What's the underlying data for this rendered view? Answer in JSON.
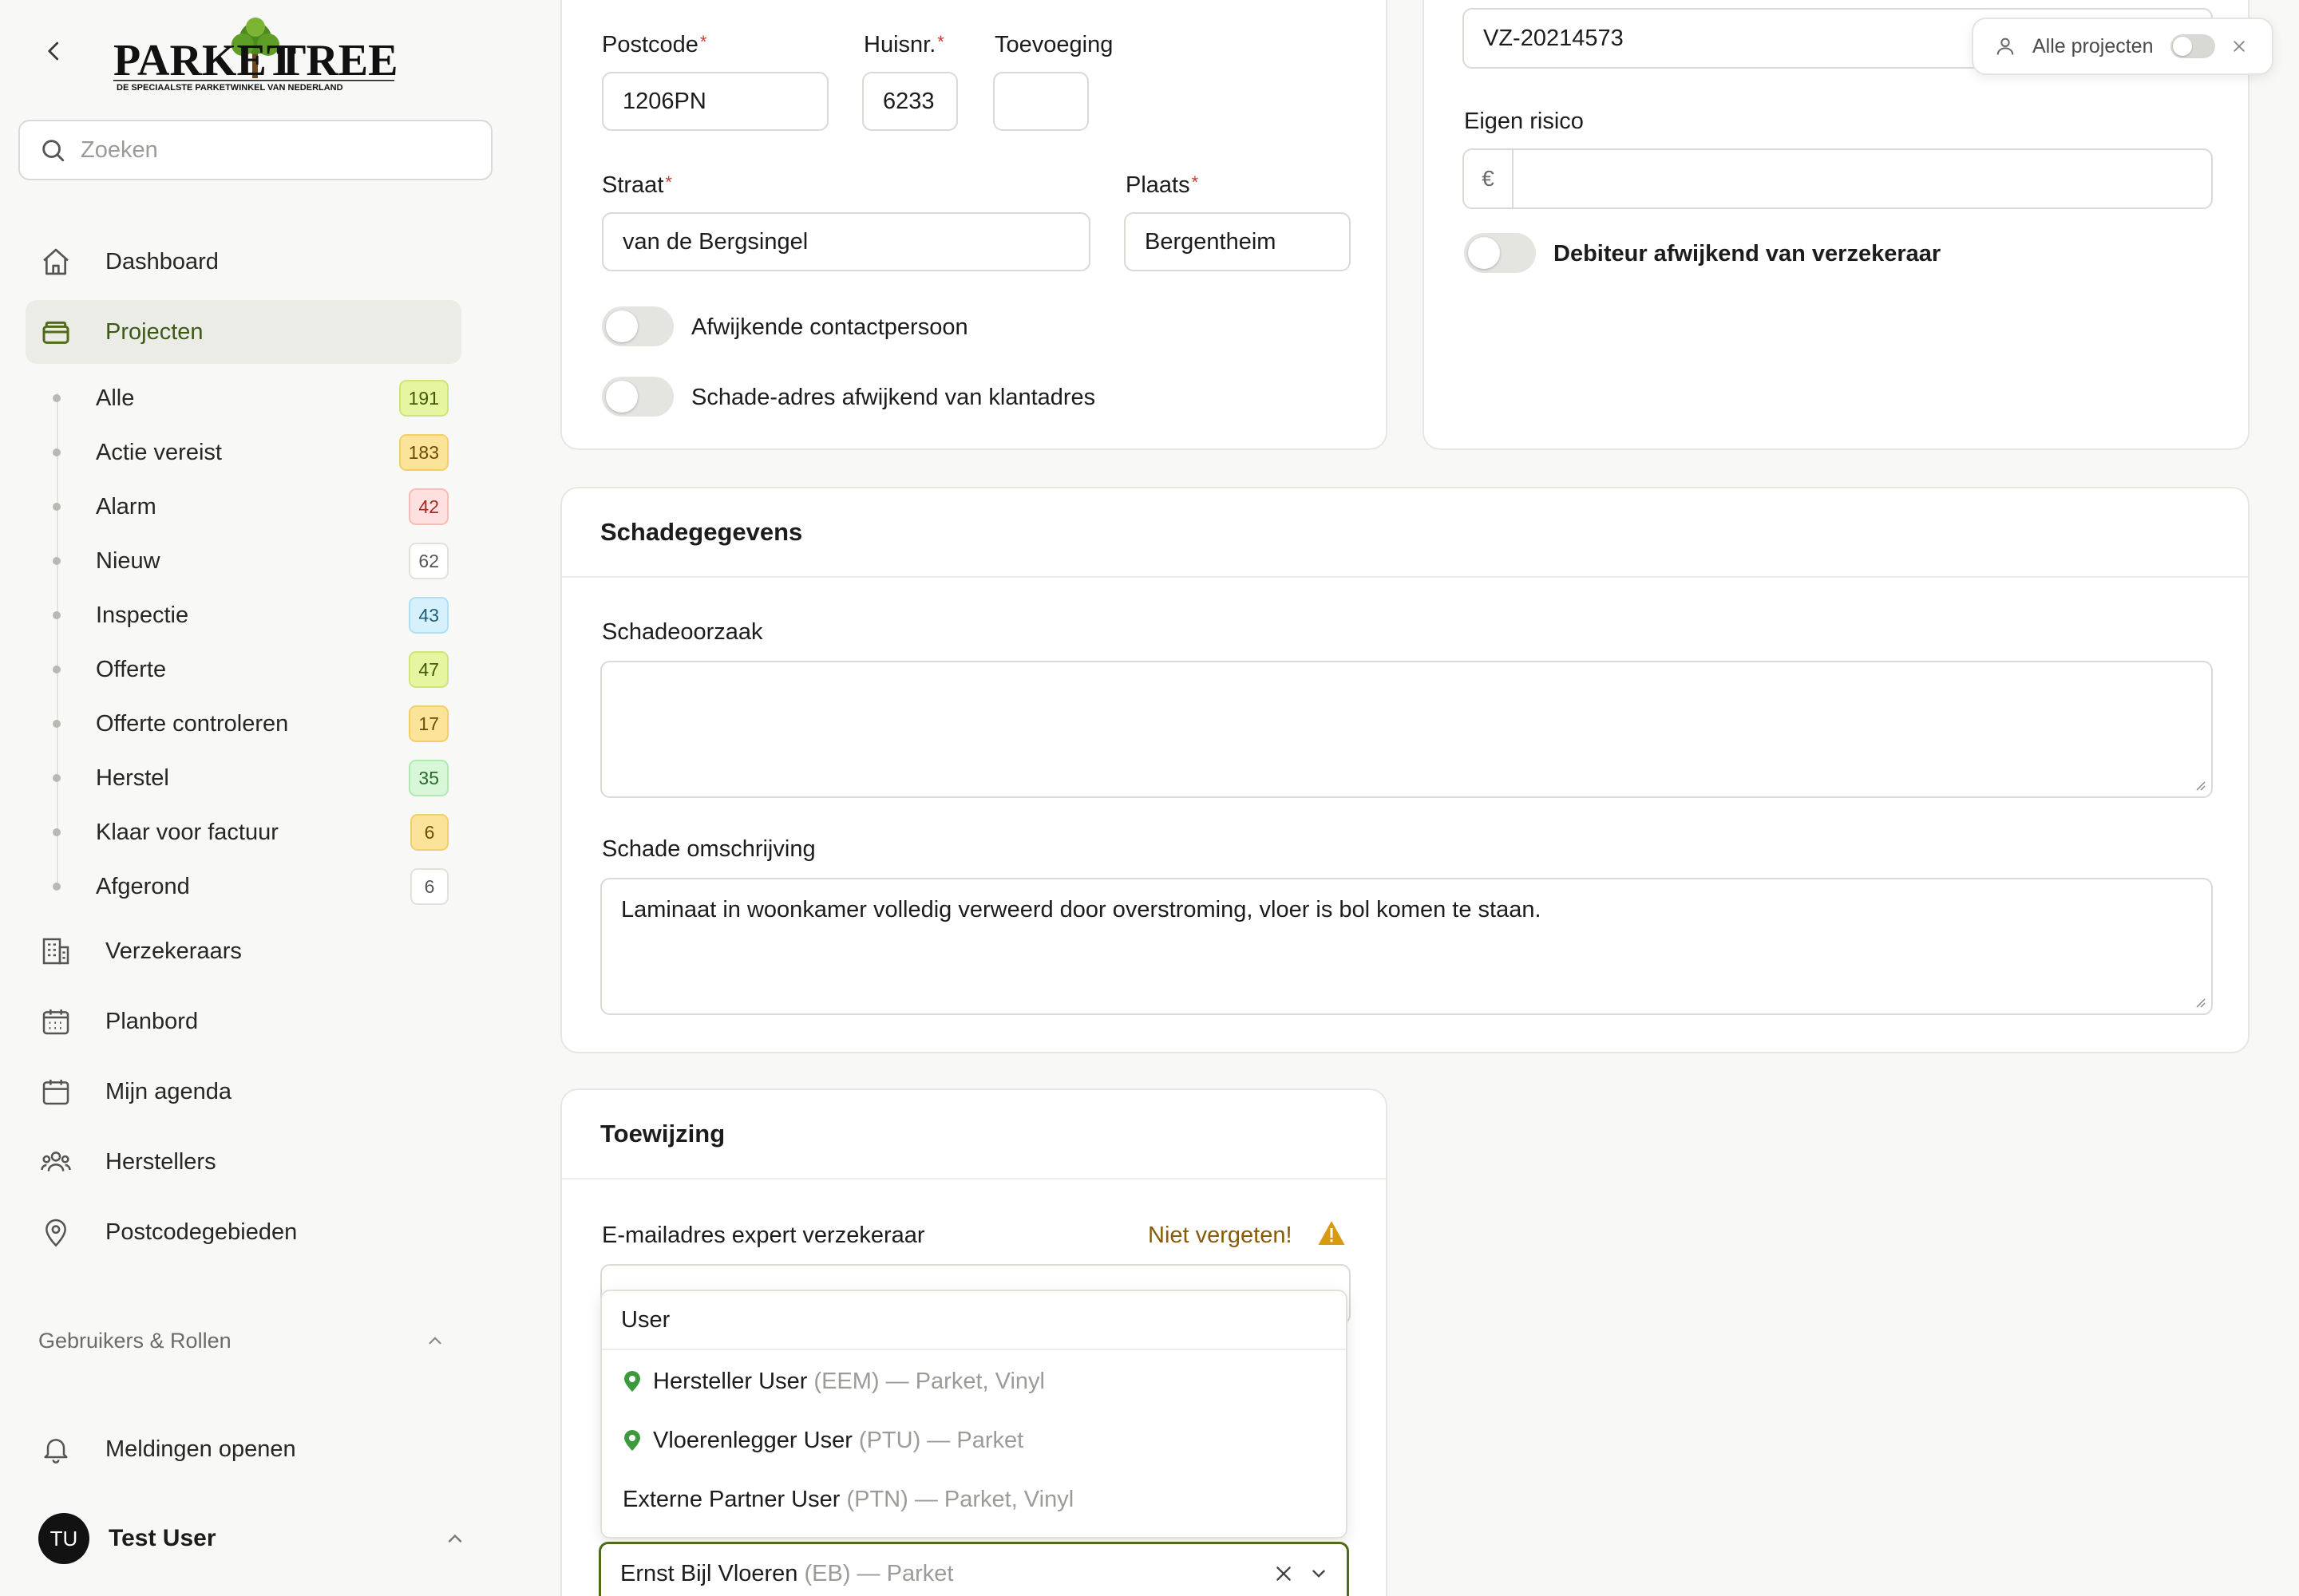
{
  "sidebar": {
    "logo_text_main": "PARKET TREE",
    "logo_tagline": "DE SPECIAALSTE PARKETWINKEL VAN NEDERLAND",
    "search_placeholder": "Zoeken",
    "nav": [
      {
        "label": "Dashboard",
        "icon": "home-icon"
      },
      {
        "label": "Projecten",
        "icon": "folder-icon",
        "active": true
      },
      {
        "label": "Verzekeraars",
        "icon": "building-icon"
      },
      {
        "label": "Planbord",
        "icon": "calendar-grid-icon"
      },
      {
        "label": "Mijn agenda",
        "icon": "calendar-icon"
      },
      {
        "label": "Herstellers",
        "icon": "users-icon"
      },
      {
        "label": "Postcodegebieden",
        "icon": "map-pin-icon"
      }
    ],
    "sub_items": [
      {
        "label": "Alle",
        "count": "191",
        "bg": "#e6f5a0",
        "fg": "#3f5a08",
        "border": "#cfe57a"
      },
      {
        "label": "Actie vereist",
        "count": "183",
        "bg": "#fbe49a",
        "fg": "#6b4b05",
        "border": "#f2cf6b"
      },
      {
        "label": "Alarm",
        "count": "42",
        "bg": "#fde0df",
        "fg": "#a52a25",
        "border": "#f6bcb9"
      },
      {
        "label": "Nieuw",
        "count": "62",
        "bg": "#ffffff",
        "fg": "#555555",
        "border": "#e1e1dd"
      },
      {
        "label": "Inspectie",
        "count": "43",
        "bg": "#d6f1fb",
        "fg": "#1b5f7a",
        "border": "#aee0f2"
      },
      {
        "label": "Offerte",
        "count": "47",
        "bg": "#e6f5a0",
        "fg": "#3f5a08",
        "border": "#cfe57a"
      },
      {
        "label": "Offerte controleren",
        "count": "17",
        "bg": "#fbe49a",
        "fg": "#6b4b05",
        "border": "#f2cf6b"
      },
      {
        "label": "Herstel",
        "count": "35",
        "bg": "#d8f6d8",
        "fg": "#2a6b2a",
        "border": "#b2e8b2"
      },
      {
        "label": "Klaar voor factuur",
        "count": "6",
        "bg": "#fbe49a",
        "fg": "#6b4b05",
        "border": "#f2cf6b"
      },
      {
        "label": "Afgerond",
        "count": "6",
        "bg": "#ffffff",
        "fg": "#555555",
        "border": "#e1e1dd"
      }
    ],
    "section_users": "Gebruikers & Rollen",
    "notifications": "Meldingen openen",
    "user": {
      "initials": "TU",
      "name": "Test User"
    }
  },
  "address": {
    "postcode_label": "Postcode",
    "postcode_value": "1206PN",
    "huisnr_label": "Huisnr.",
    "huisnr_value": "6233",
    "toevoeging_label": "Toevoeging",
    "toevoeging_value": "",
    "straat_label": "Straat",
    "straat_value": "van de Bergsingel",
    "plaats_label": "Plaats",
    "plaats_value": "Bergentheim",
    "toggle_contact": "Afwijkende contactpersoon",
    "toggle_schade_adres": "Schade-adres afwijkend van klantadres"
  },
  "insurance": {
    "polis_value": "VZ-20214573",
    "eigen_risico_label": "Eigen risico",
    "currency_symbol": "€",
    "eigen_risico_value": "",
    "toggle_debiteur": "Debiteur afwijkend van verzekeraar"
  },
  "filter_pill": {
    "label": "Alle projecten"
  },
  "schade": {
    "title": "Schadegegevens",
    "oorzaak_label": "Schadeoorzaak",
    "oorzaak_value": "",
    "omschrijving_label": "Schade omschrijving",
    "omschrijving_value": "Laminaat in woonkamer volledig verweerd door overstroming, vloer is bol komen te staan."
  },
  "toewijzing": {
    "title": "Toewijzing",
    "email_label": "E-mailadres expert verzekeraar",
    "warning_text": "Niet vergeten!",
    "dropdown_search": "User",
    "options": [
      {
        "name": "Hersteller User",
        "suffix": " (EEM) — Parket, Vinyl",
        "pin": true
      },
      {
        "name": "Vloerenlegger User",
        "suffix": " (PTU) — Parket",
        "pin": true
      },
      {
        "name": "Externe Partner User",
        "suffix": " (PTN) — Parket, Vinyl",
        "pin": false
      }
    ],
    "selected_name": "Ernst Bijl Vloeren",
    "selected_suffix": " (EB) — Parket"
  },
  "colors": {
    "accent": "#4f6b19",
    "warning": "#c98a0c",
    "pin_green": "#3c9a3c",
    "required": "#d2372f"
  }
}
